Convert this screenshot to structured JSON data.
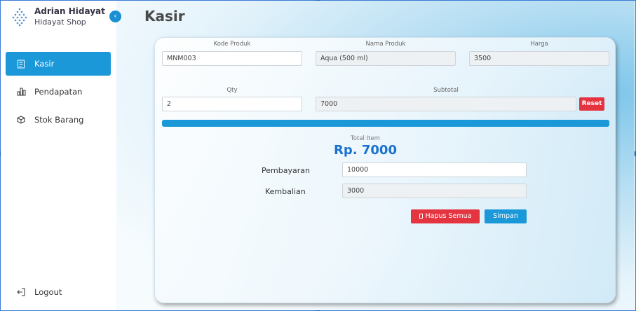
{
  "colors": {
    "accent": "#1a98d8",
    "danger": "#e3343f",
    "total": "#1a72d0"
  },
  "brand": {
    "name": "Adrian Hidayat",
    "shop": "Hidayat Shop",
    "logo_icon": "dot-fan-logo"
  },
  "sidebar": {
    "collapse_icon": "chevron-left-icon",
    "items": [
      {
        "label": "Kasir",
        "icon": "register-icon",
        "active": true
      },
      {
        "label": "Pendapatan",
        "icon": "bar-chart-icon",
        "active": false
      },
      {
        "label": "Stok Barang",
        "icon": "box-icon",
        "active": false
      }
    ],
    "logout": {
      "label": "Logout",
      "icon": "logout-icon"
    }
  },
  "page": {
    "title": "Kasir"
  },
  "form": {
    "kode_label": "Kode Produk",
    "kode_value": "MNM003",
    "nama_label": "Nama Produk",
    "nama_value": "Aqua (500 ml)",
    "harga_label": "Harga",
    "harga_value": "3500",
    "qty_label": "Qty",
    "qty_value": "2",
    "subtotal_label": "Subtotal",
    "subtotal_value": "7000",
    "reset_label": "Reset"
  },
  "summary": {
    "total_label": "Total Item",
    "total_value": "Rp. 7000",
    "pembayaran_label": "Pembayaran",
    "pembayaran_value": "10000",
    "kembalian_label": "Kembalian",
    "kembalian_value": "3000",
    "hapus_label": "Hapus Semua",
    "simpan_label": "Simpan"
  }
}
